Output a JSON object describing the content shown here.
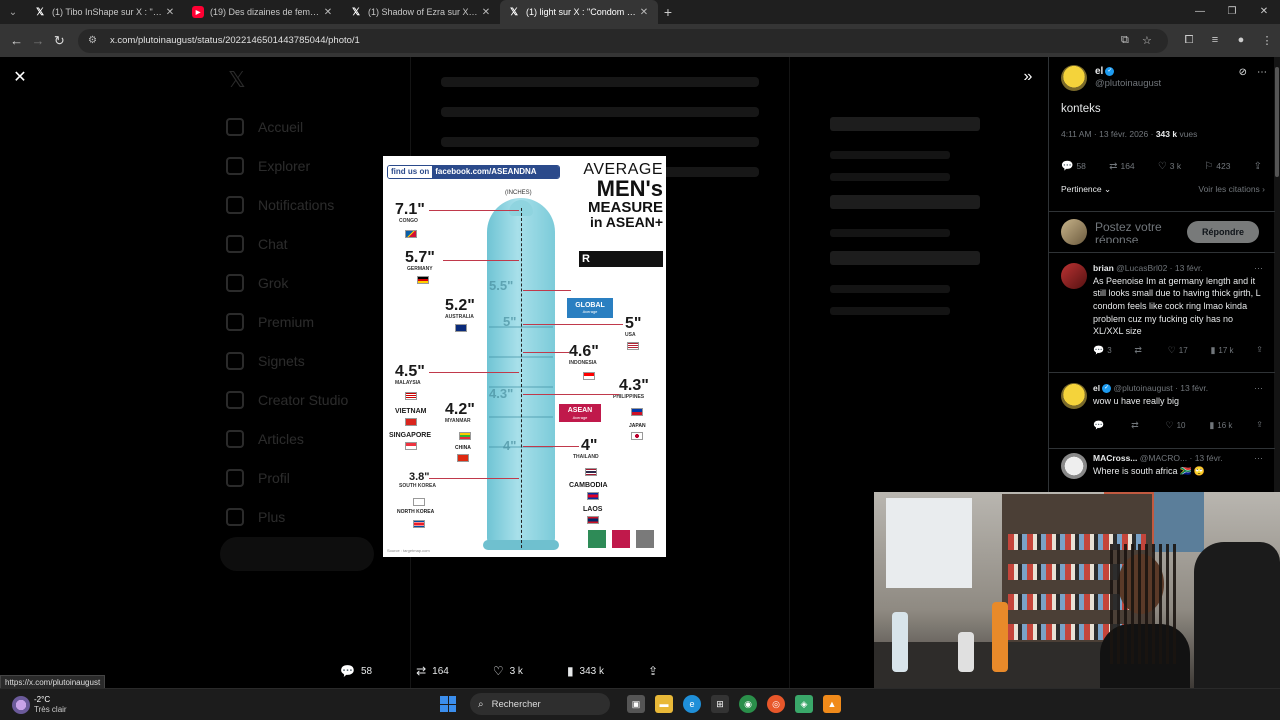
{
  "browser": {
    "tabs": [
      {
        "icon": "x-logo-icon",
        "title": "(1) Tibo InShape sur X : \"Entraîn",
        "active": false
      },
      {
        "icon": "youtube-icon",
        "title": "(19) Des dizaines de femmes vo",
        "active": false
      },
      {
        "icon": "x-logo-icon",
        "title": "(1) Shadow of Ezra sur X : \"Bara",
        "active": false
      },
      {
        "icon": "x-logo-icon",
        "title": "(1) light sur X : \"Condom For Ki",
        "active": true
      }
    ],
    "url": "x.com/plutoinaugust/status/2022146501443785044/photo/1"
  },
  "viewer": {
    "reply_count": "58",
    "repost_count": "164",
    "like_count": "3 k",
    "view_count": "343 k"
  },
  "status_url": "https://x.com/plutoinaugust",
  "background_nav": [
    "Accueil",
    "Explorer",
    "Notifications",
    "Chat",
    "Grok",
    "Premium",
    "Signets",
    "Creator Studio",
    "Articles",
    "Profil",
    "Plus"
  ],
  "infographic": {
    "badge_prefix": "find us on",
    "badge_site": "facebook.com/ASEANDNA",
    "inches_label": "(INCHES)",
    "headline": [
      "AVERAGE",
      "MEN's",
      "MEASURE",
      "in ASEAN+"
    ],
    "rating": "R",
    "global_label": "GLOBAL",
    "global_sub": "Average",
    "asean_label": "ASEAN",
    "asean_sub": "Average",
    "source": "Source : targetmap.com",
    "entries": [
      {
        "value": "7.1\"",
        "country": "CONGO"
      },
      {
        "value": "5.7\"",
        "country": "GERMANY"
      },
      {
        "value": "5.2\"",
        "country": "AUSTRALIA"
      },
      {
        "value": "5\"",
        "country": "USA"
      },
      {
        "value": "4.6\"",
        "country": "INDONESIA"
      },
      {
        "value": "4.5\"",
        "country": "MALAYSIA"
      },
      {
        "value": "4.3\"",
        "country": "PHILIPPINES"
      },
      {
        "value": "4.2\"",
        "country": "MYANMAR"
      },
      {
        "value": "4\"",
        "country": "THAILAND"
      },
      {
        "value": "3.8\"",
        "country": "SOUTH KOREA"
      }
    ],
    "extra_countries": [
      "VIETNAM",
      "SINGAPORE",
      "CHINA",
      "JAPAN",
      "CAMBODIA",
      "LAOS",
      "NORTH KOREA"
    ],
    "scale_marks": [
      "5.5\"",
      "5\"",
      "4.3\"",
      "4\""
    ]
  },
  "post": {
    "author_name": "el",
    "author_handle": "@plutoinaugust",
    "text": "konteks",
    "time": "4:11 AM · 13 févr. 2026 · ",
    "views_bold": "343 k",
    "views_suffix": " vues",
    "stats": {
      "replies": "58",
      "reposts": "164",
      "likes": "3 k",
      "bookmarks": "423"
    },
    "sort_label": "Pertinence",
    "quotes_label": "Voir les citations"
  },
  "reply_composer": {
    "placeholder": "Postez votre réponse",
    "button": "Répondre"
  },
  "replies": [
    {
      "name": "brian",
      "handle": "@LucasBrl02",
      "date": "13 févr.",
      "text": "As Peenoise Im at germany length and it still looks small due to having thick girth, L condom feels like cock ring lmao kinda problem cuz my fucking city has no XL/XXL size",
      "replies": "3",
      "reposts": "",
      "likes": "17",
      "views": "17 k"
    },
    {
      "name": "el",
      "handle": "@plutoinaugust",
      "date": "13 févr.",
      "text": "wow u have really big",
      "replies": "",
      "reposts": "",
      "likes": "10",
      "views": "16 k"
    },
    {
      "name": "MACross...",
      "handle": "@MACRO...",
      "date": "13 févr.",
      "text": "Where is south africa 🇿🇦 🙄"
    }
  ],
  "taskbar": {
    "temp": "-2°C",
    "weather": "Très clair",
    "search": "Rechercher"
  },
  "colors": {
    "x_blue": "#1d9bf0",
    "reply_button": "#787a7a",
    "condom": "#a8e0ea",
    "global_badge": "#2a7fc1",
    "asean_badge": "#c0194b"
  }
}
